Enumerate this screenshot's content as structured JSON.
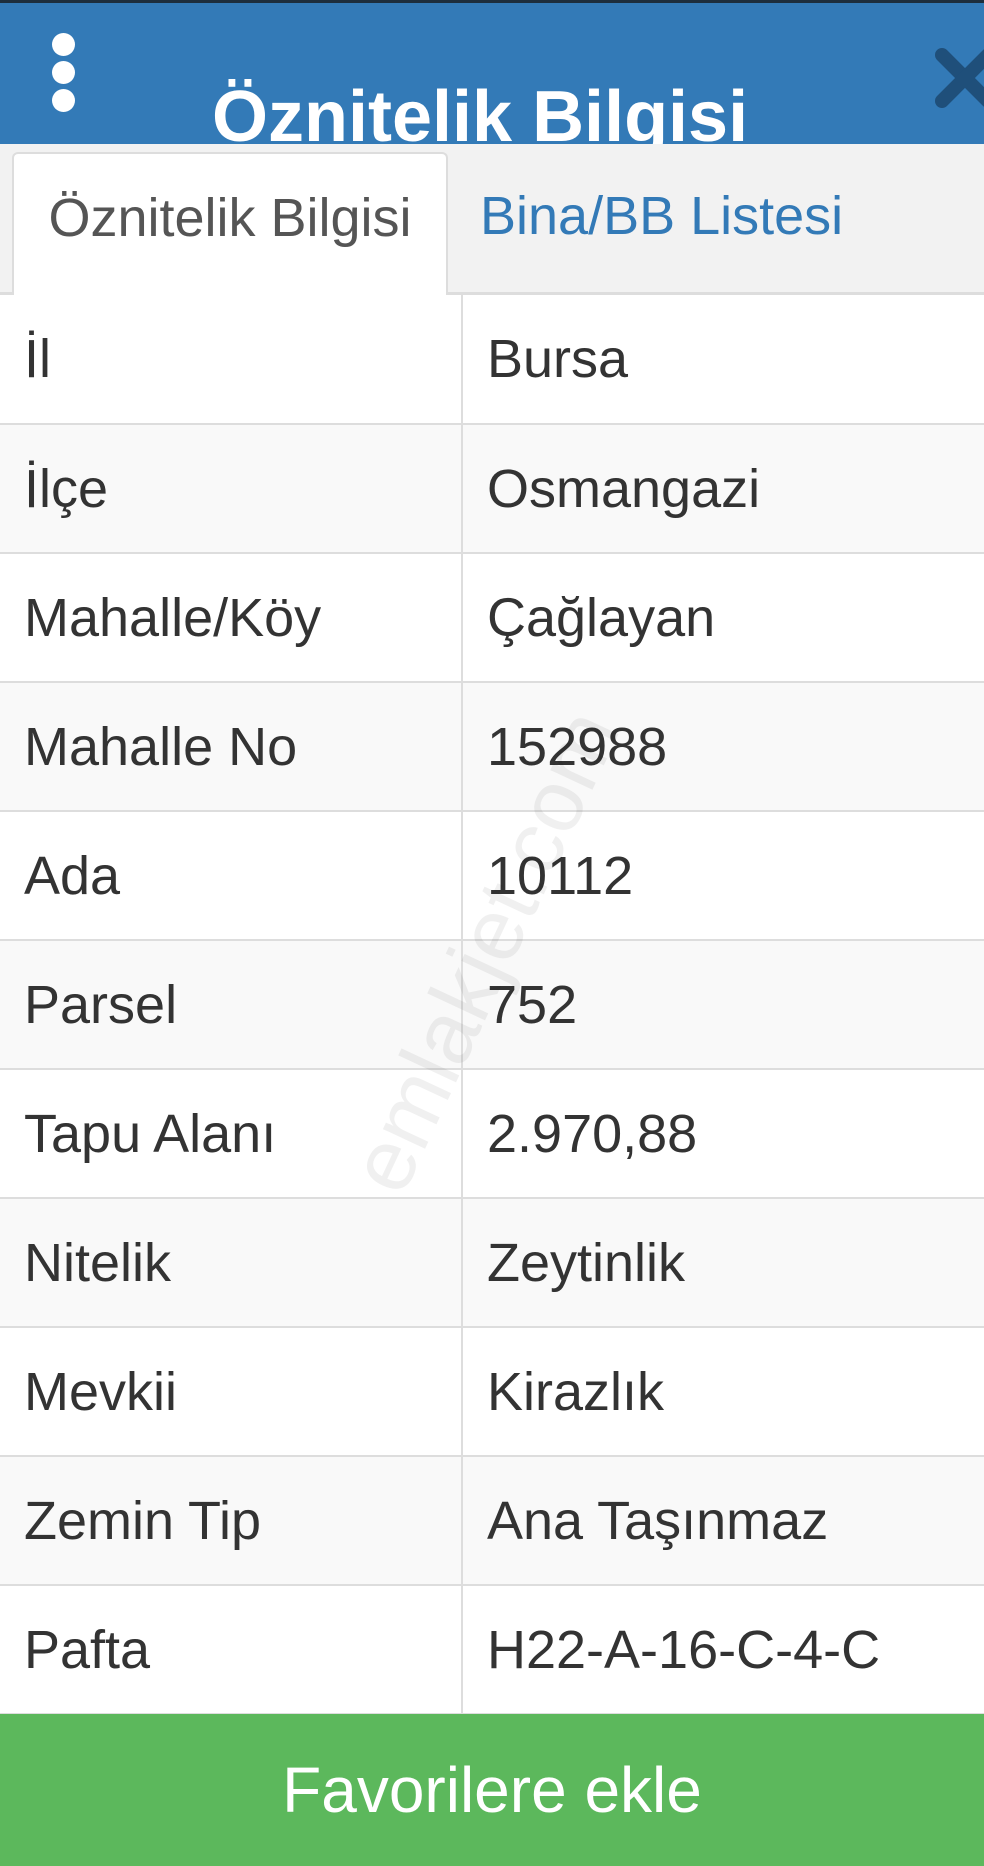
{
  "header": {
    "title": "Öznitelik Bilgisi",
    "menu_icon": "kebab-menu-icon",
    "close_icon": "close-icon",
    "bg_color": "#337ab7"
  },
  "tabs": [
    {
      "label": "Öznitelik Bilgisi",
      "active": true
    },
    {
      "label": "Bina/BB Listesi",
      "active": false
    }
  ],
  "attributes": [
    {
      "key": "İl",
      "value": "Bursa"
    },
    {
      "key": "İlçe",
      "value": "Osmangazi"
    },
    {
      "key": "Mahalle/Köy",
      "value": "Çağlayan"
    },
    {
      "key": "Mahalle No",
      "value": "152988"
    },
    {
      "key": "Ada",
      "value": "10112"
    },
    {
      "key": "Parsel",
      "value": "752"
    },
    {
      "key": "Tapu Alanı",
      "value": "2.970,88"
    },
    {
      "key": "Nitelik",
      "value": "Zeytinlik"
    },
    {
      "key": "Mevkii",
      "value": "Kirazlık"
    },
    {
      "key": "Zemin Tip",
      "value": "Ana Taşınmaz"
    },
    {
      "key": "Pafta",
      "value": "H22-A-16-C-4-C"
    }
  ],
  "watermark": "emlakjet.com",
  "footer": {
    "favorite_label": "Favorilere ekle",
    "button_color": "#5cb85c"
  }
}
